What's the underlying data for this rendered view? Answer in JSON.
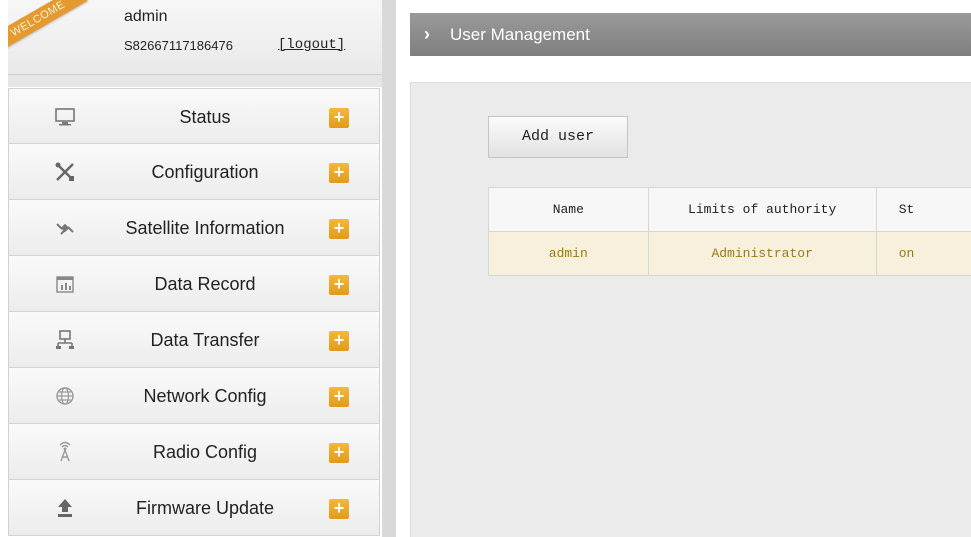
{
  "user_panel": {
    "welcome": "WELCOME",
    "username": "admin",
    "serial": "S82667117186476",
    "logout": "[logout]"
  },
  "menu": [
    {
      "label": "Status",
      "icon": "monitor-icon"
    },
    {
      "label": "Configuration",
      "icon": "tools-icon"
    },
    {
      "label": "Satellite Information",
      "icon": "satellite-icon"
    },
    {
      "label": "Data Record",
      "icon": "calendar-icon"
    },
    {
      "label": "Data Transfer",
      "icon": "network-icon"
    },
    {
      "label": "Network Config",
      "icon": "globe-icon"
    },
    {
      "label": "Radio Config",
      "icon": "radio-tower-icon"
    },
    {
      "label": "Firmware Update",
      "icon": "upload-icon"
    }
  ],
  "menu_expand_symbol": "+",
  "page": {
    "chevron": "›",
    "title": "User Management",
    "add_user": "Add user"
  },
  "table": {
    "headers": [
      "Name",
      "Limits of authority",
      "St"
    ],
    "rows": [
      [
        "admin",
        "Administrator",
        "on"
      ]
    ]
  },
  "colors": {
    "accent_orange": "#e39a18",
    "title_bar": "#8a8a8a",
    "row_text": "#9a7a12",
    "row_bg": "#f6f0dc"
  }
}
